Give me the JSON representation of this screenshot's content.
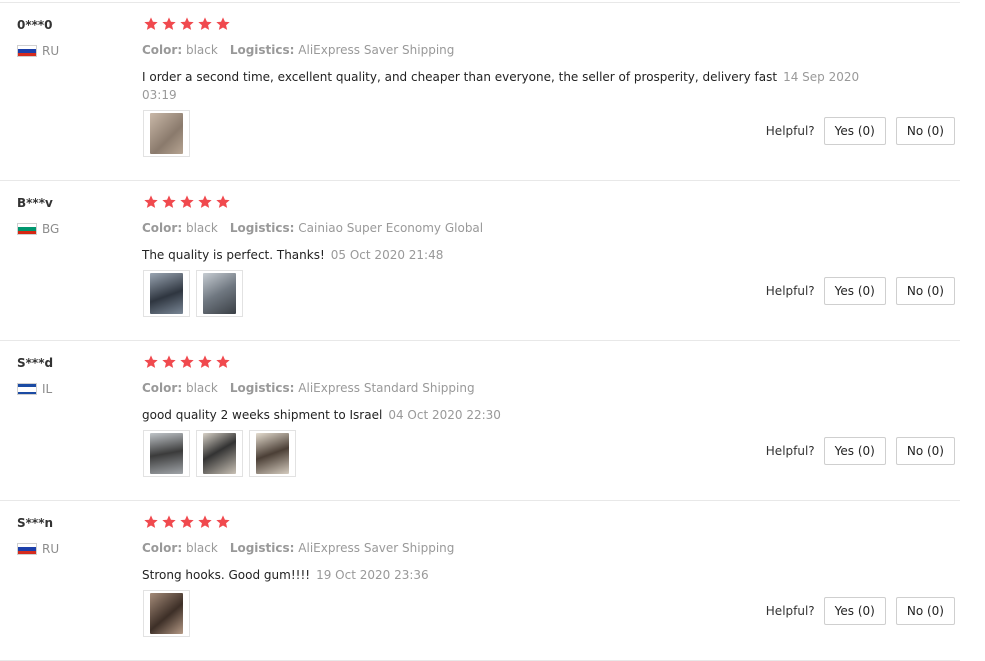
{
  "colors": {
    "star": "#f0494e",
    "meta_text": "#999999",
    "divider": "#e8e8e8",
    "flag_ru": [
      "#ffffff",
      "#1c3faa",
      "#d52b1e"
    ],
    "flag_bg": [
      "#ffffff",
      "#00966e",
      "#d62612"
    ],
    "flag_il": [
      "#ffffff",
      "#1b4ba3",
      "#ffffff"
    ]
  },
  "labels": {
    "color_label": "Color:",
    "logistics_label": "Logistics:",
    "helpful_label": "Helpful?"
  },
  "reviews": [
    {
      "user": "0***0",
      "country": "RU",
      "flag": "flag_ru",
      "stars": 5,
      "color": "black",
      "logistics": "AliExpress Saver Shipping",
      "text": "I order a second time, excellent quality, and cheaper than everyone, the seller of prosperity, delivery fast",
      "date": "14 Sep 2020 03:19",
      "photos": [
        "photo-hook",
        "photo-hook"
      ],
      "photo_count": 1,
      "yes": "Yes (0)",
      "no": "No (0)"
    },
    {
      "user": "B***v",
      "country": "BG",
      "flag": "flag_bg",
      "stars": 5,
      "color": "black",
      "logistics": "Cainiao Super Economy Global",
      "text": "The quality is perfect. Thanks!",
      "date": "05 Oct 2020 21:48",
      "photo_count": 2,
      "yes": "Yes (0)",
      "no": "No (0)"
    },
    {
      "user": "S***d",
      "country": "IL",
      "flag": "flag_il",
      "stars": 5,
      "color": "black",
      "logistics": "AliExpress Standard Shipping",
      "text": "good quality 2 weeks shipment to Israel",
      "date": "04 Oct 2020 22:30",
      "photo_count": 3,
      "yes": "Yes (0)",
      "no": "No (0)"
    },
    {
      "user": "S***n",
      "country": "RU",
      "flag": "flag_ru",
      "stars": 5,
      "color": "black",
      "logistics": "AliExpress Saver Shipping",
      "text": "Strong hooks. Good gum!!!!",
      "date": "19 Oct 2020 23:36",
      "photo_count": 1,
      "yes": "Yes (0)",
      "no": "No (0)"
    }
  ]
}
